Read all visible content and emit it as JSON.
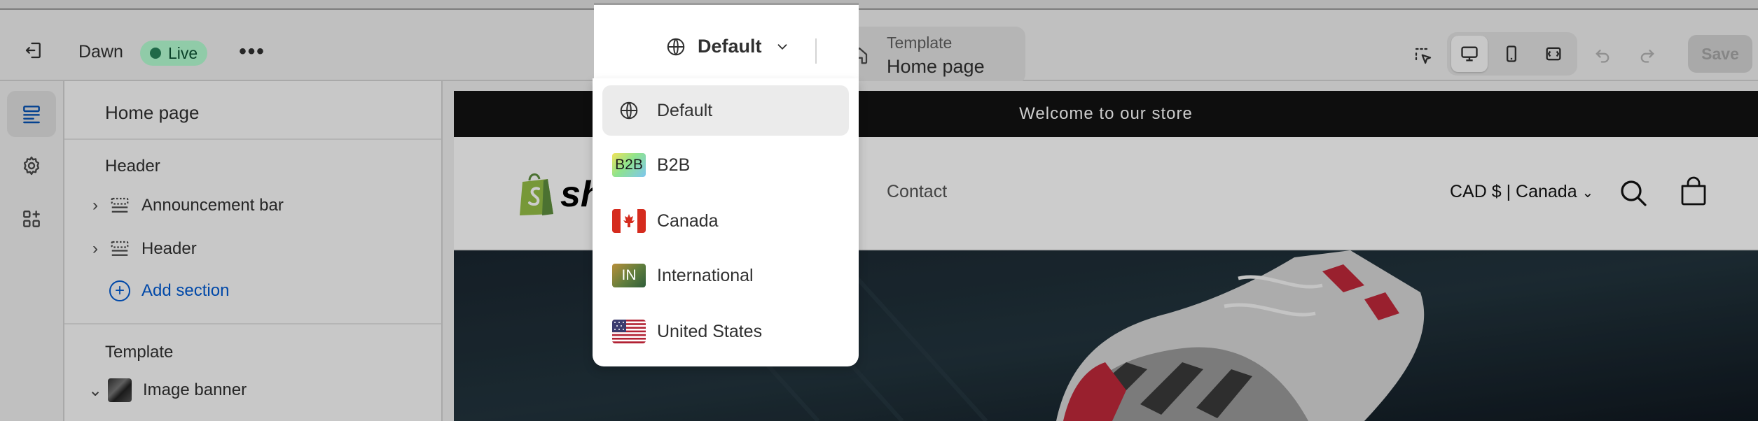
{
  "topbar": {
    "store_name": "Dawn",
    "status_badge": "Live",
    "more_label": "•••",
    "template": {
      "label": "Template",
      "page": "Home page"
    },
    "save_label": "Save"
  },
  "market_selector": {
    "selected": "Default",
    "options": [
      {
        "label": "Default",
        "icon": "globe-icon"
      },
      {
        "label": "B2B",
        "icon": "b2b-market-icon",
        "badge": "B2B"
      },
      {
        "label": "Canada",
        "icon": "canada-flag-icon"
      },
      {
        "label": "International",
        "icon": "international-market-icon",
        "badge": "IN"
      },
      {
        "label": "United States",
        "icon": "us-flag-icon"
      }
    ]
  },
  "sidebar": {
    "title": "Home page",
    "header_group": {
      "heading": "Header",
      "items": [
        {
          "label": "Announcement bar"
        },
        {
          "label": "Header"
        }
      ],
      "add_section": "Add section"
    },
    "template_group": {
      "heading": "Template",
      "items": [
        {
          "label": "Image banner"
        }
      ]
    }
  },
  "preview": {
    "announcement": "Welcome to our store",
    "logo_text": "sh",
    "nav": {
      "contact": "Contact"
    },
    "country_selector": "CAD $ | Canada"
  },
  "colors": {
    "live_badge_bg": "#b4fed2",
    "accent_blue": "#005bd3",
    "announcement_bg": "#121212"
  }
}
